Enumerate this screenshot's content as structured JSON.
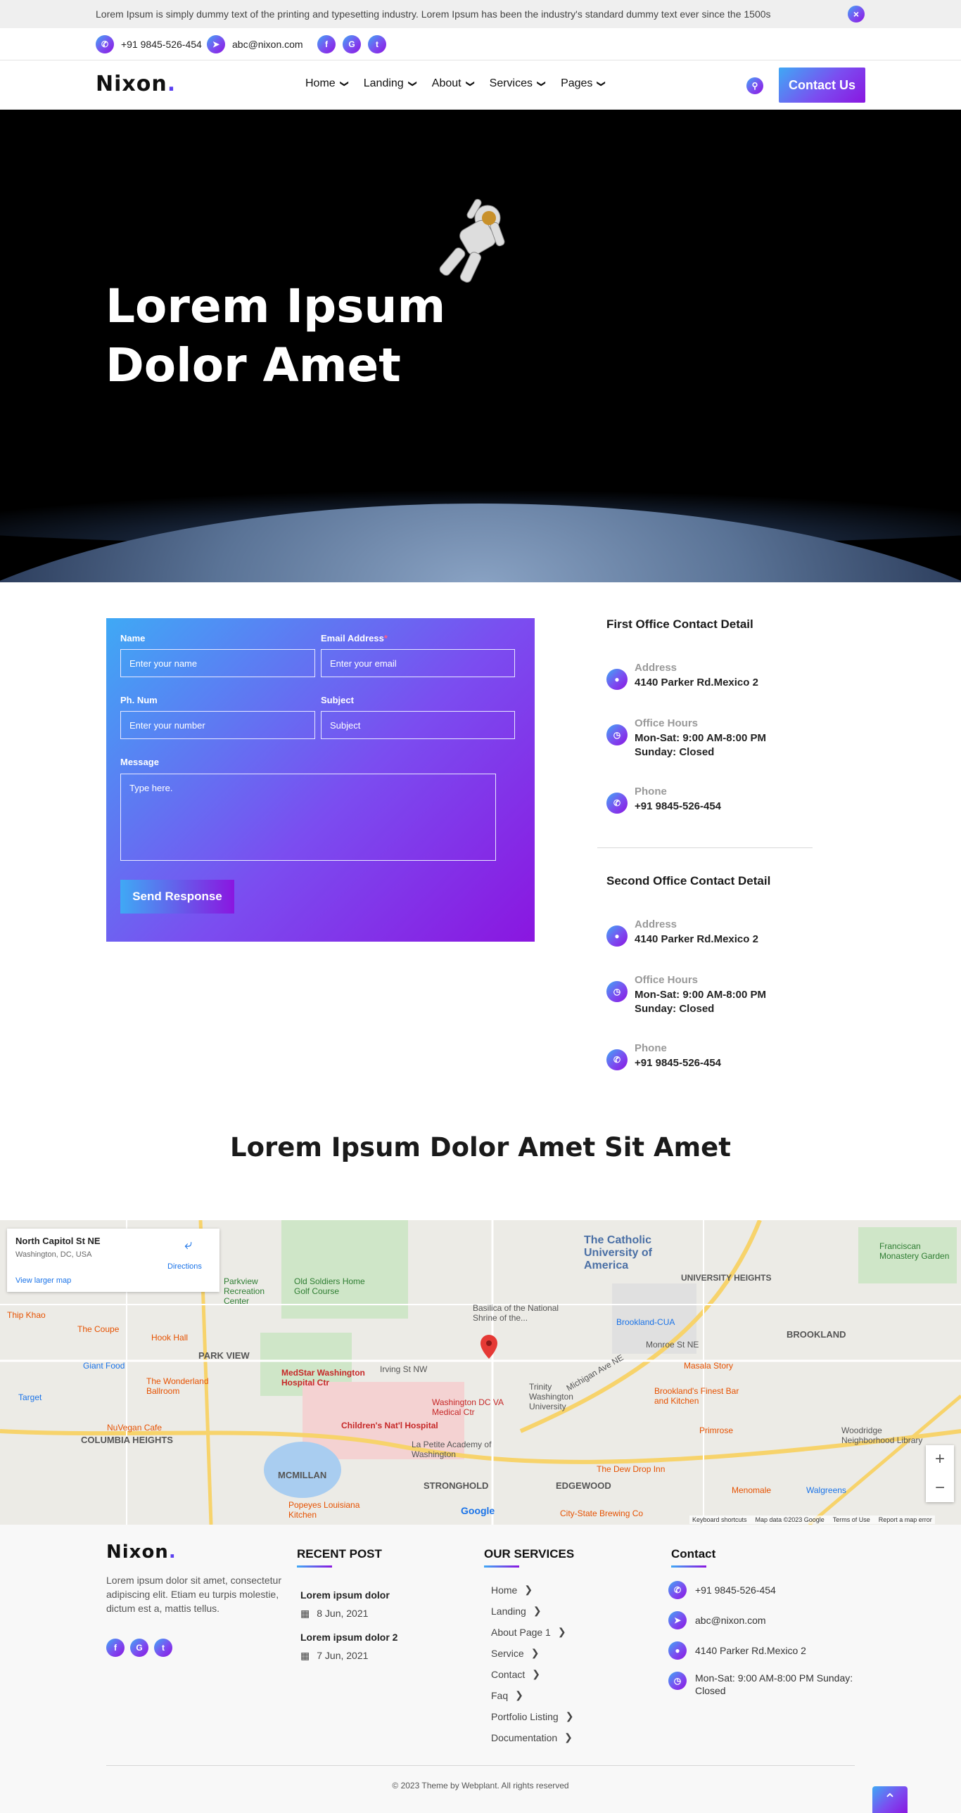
{
  "announcement": {
    "text": "Lorem Ipsum is simply dummy text of the printing and typesetting industry. Lorem Ipsum has been the industry's standard dummy text ever since the 1500s",
    "close": "×"
  },
  "strip": {
    "phone": "+91 9845-526-454",
    "email": "abc@nixon.com",
    "social": [
      "f",
      "G",
      "t"
    ]
  },
  "brand": {
    "logo": "Nixon",
    "dot": "."
  },
  "nav": {
    "items": [
      "Home",
      "Landing",
      "About",
      "Services",
      "Pages"
    ],
    "cta": "Contact Us"
  },
  "hero": {
    "title_line1": "Lorem Ipsum",
    "title_line2": "Dolor Amet"
  },
  "form": {
    "name_label": "Name",
    "name_placeholder": "Enter your name",
    "email_label": "Email Address",
    "email_required": "*",
    "email_placeholder": "Enter your email",
    "phone_label": "Ph. Num",
    "phone_placeholder": "Enter your number",
    "subject_label": "Subject",
    "subject_placeholder": "Subject",
    "message_label": "Message",
    "message_placeholder": "Type here.",
    "send": "Send Response"
  },
  "offices": [
    {
      "title": "First Office Contact Detail",
      "address_label": "Address",
      "address": "4140 Parker Rd.Mexico 2",
      "hours_label": "Office Hours",
      "hours1": "Mon-Sat: 9:00 AM-8:00 PM",
      "hours2": "Sunday: Closed",
      "phone_label": "Phone",
      "phone": "+91 9845-526-454"
    },
    {
      "title": "Second Office Contact Detail",
      "address_label": "Address",
      "address": "4140 Parker Rd.Mexico 2",
      "hours_label": "Office Hours",
      "hours1": "Mon-Sat: 9:00 AM-8:00 PM",
      "hours2": "Sunday: Closed",
      "phone_label": "Phone",
      "phone": "+91 9845-526-454"
    }
  ],
  "section_title": "Lorem Ipsum Dolor Amet Sit Amet",
  "map": {
    "place": "North Capitol St NE",
    "region": "Washington, DC, USA",
    "larger": "View larger map",
    "directions": "Directions",
    "labels": [
      "The Catholic University of America",
      "UNIVERSITY HEIGHTS",
      "BROOKLAND",
      "PARK VIEW",
      "COLUMBIA HEIGHTS",
      "MCMILLAN",
      "STRONGHOLD",
      "EDGEWOOD",
      "Old Soldiers Home Golf Course",
      "Basilica of the National Shrine of the...",
      "MedStar Washington Hospital Ctr",
      "Washington DC VA Medical Ctr",
      "Children's Nat'l Hospital",
      "La Petite Academy of Washington",
      "Trinity Washington University",
      "Brookland-CUA",
      "Masala Story",
      "Brookland's Finest Bar and Kitchen",
      "Primrose",
      "Woodridge Neighborhood Library",
      "Walgreens",
      "Menomale",
      "The Dew Drop Inn",
      "City-State Brewing Co",
      "Hook Hall",
      "The Coupe",
      "Giant Food",
      "Target",
      "The Wonderland Ballroom",
      "NuVegan Cafe",
      "Popeyes Louisiana Kitchen",
      "Thip Khao",
      "Parkview Recreation Center",
      "Franciscan Monastery Garden",
      "Michigan Ave NE",
      "Irving St NW",
      "Monroe St NE"
    ],
    "google": "Google",
    "footer": [
      "Keyboard shortcuts",
      "Map data ©2023 Google",
      "Terms of Use",
      "Report a map error"
    ]
  },
  "footer": {
    "about": "Lorem ipsum dolor sit amet, consectetur adipiscing elit. Etiam eu turpis molestie, dictum est a, mattis tellus.",
    "recent_title": "RECENT POST",
    "posts": [
      {
        "title": "Lorem ipsum dolor",
        "date": "8 Jun, 2021"
      },
      {
        "title": "Lorem ipsum dolor 2",
        "date": "7 Jun, 2021"
      }
    ],
    "services_title": "OUR SERVICES",
    "services": [
      "Home",
      "Landing",
      "About Page 1",
      "Service",
      "Contact",
      "Faq",
      "Portfolio Listing",
      "Documentation"
    ],
    "contact_title": "Contact",
    "contact": [
      "+91 9845-526-454",
      "abc@nixon.com",
      "4140 Parker Rd.Mexico 2",
      "Mon-Sat: 9:00 AM-8:00 PM Sunday: Closed"
    ],
    "copyright": "© 2023 Theme by Webplant. All rights reserved"
  },
  "colors": {
    "accent_start": "#3fa9f5",
    "accent_end": "#8a16e0"
  }
}
